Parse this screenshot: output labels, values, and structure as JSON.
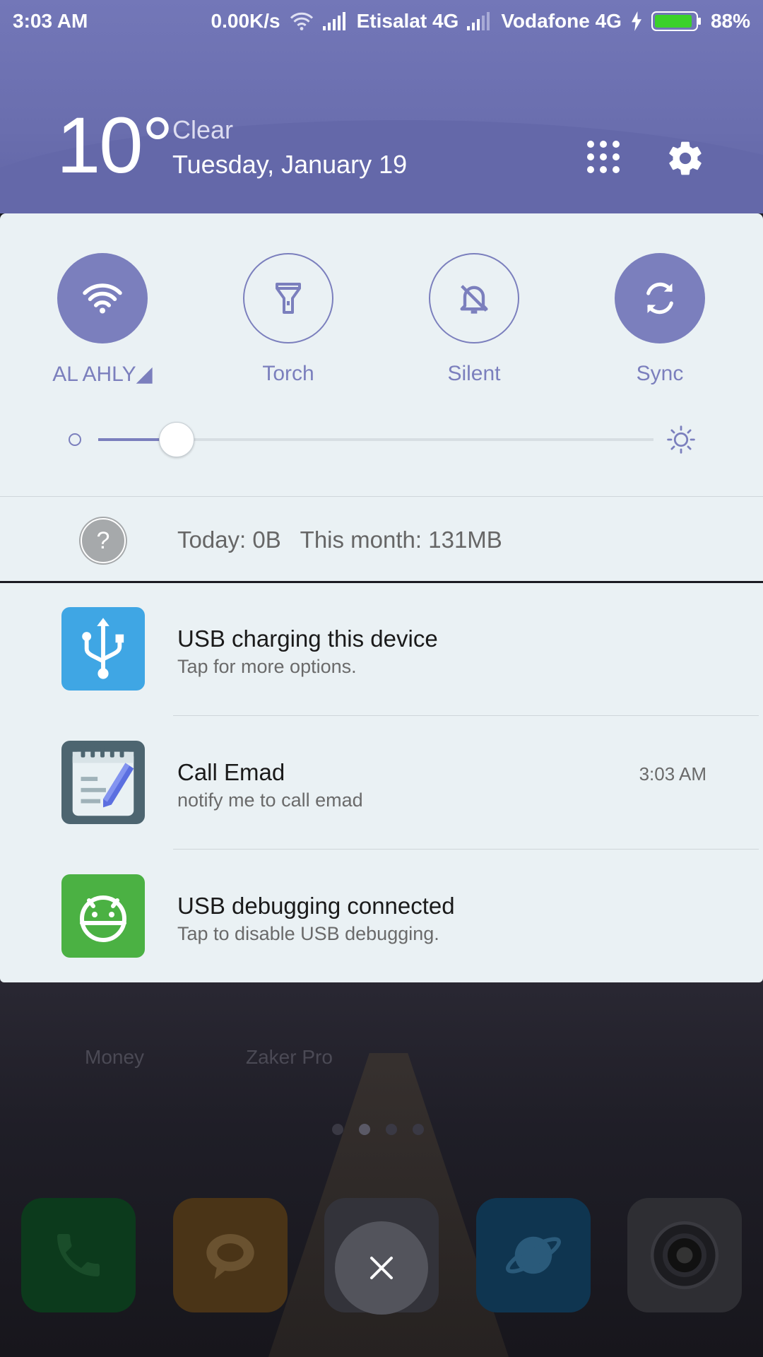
{
  "status_bar": {
    "time": "3:03 AM",
    "net_speed": "0.00K/s",
    "carrier1": "Etisalat 4G",
    "carrier2": "Vodafone 4G",
    "battery": "88%",
    "icons": [
      "wifi-icon",
      "signal-icon",
      "signal-icon",
      "charging-icon",
      "battery-icon"
    ]
  },
  "header": {
    "temperature": "10°",
    "condition": "Clear",
    "date": "Tuesday, January 19"
  },
  "toggles": [
    {
      "label": "AL AHLY◢",
      "icon": "wifi-icon",
      "active": true
    },
    {
      "label": "Torch",
      "icon": "torch-icon",
      "active": false
    },
    {
      "label": "Silent",
      "icon": "bell-off-icon",
      "active": false
    },
    {
      "label": "Sync",
      "icon": "sync-icon",
      "active": true
    }
  ],
  "brightness": {
    "level": 0.14
  },
  "data_usage": {
    "text": "Today: 0B   This month: 131MB"
  },
  "notifications": [
    {
      "title": "USB charging this device",
      "text": "Tap for more options.",
      "time": "",
      "icon": "usb-icon",
      "color": "#3fa6e4"
    },
    {
      "title": "Call Emad",
      "text": "notify me to call emad",
      "time": "3:03 AM",
      "icon": "notepad-icon",
      "color": "#4d6570"
    },
    {
      "title": "USB debugging connected",
      "text": "Tap to disable USB debugging.",
      "time": "",
      "icon": "android-icon",
      "color": "#4bb143"
    }
  ],
  "launcher": {
    "app_labels": [
      "Money",
      "Zaker Pro"
    ],
    "dock": [
      "phone-icon",
      "messages-icon",
      "contacts-icon",
      "browser-icon",
      "camera-icon"
    ],
    "dock_colors": [
      "#0c3a1c",
      "#4a3417",
      "#33333a",
      "#0f3550",
      "#2e2e33"
    ]
  }
}
